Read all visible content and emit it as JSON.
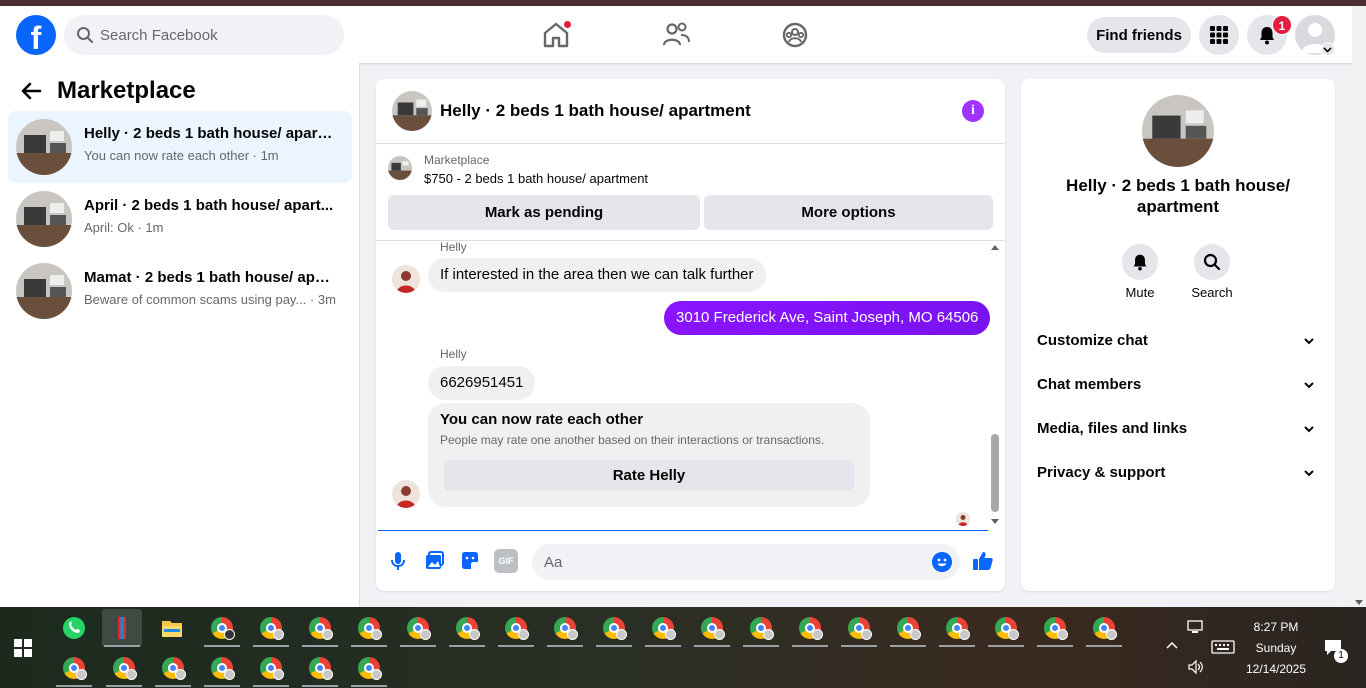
{
  "topnav": {
    "search_placeholder": "Search Facebook",
    "find_friends": "Find friends",
    "notification_count": "1",
    "logo": "f"
  },
  "sidebar": {
    "title": "Marketplace",
    "conversations": [
      {
        "title": "Helly · 2 beds 1 bath house/ apart...",
        "subtitle": "You can now rate each other · 1m",
        "active": true
      },
      {
        "title": "April · 2 beds 1 bath house/ apart...",
        "subtitle": "April: Ok · 1m",
        "active": false
      },
      {
        "title": "Mamat · 2 beds 1 bath house/ apa...",
        "subtitle": "Beware of common scams using pay... · 3m",
        "active": false
      }
    ]
  },
  "chat": {
    "header_title": "Helly · 2 beds 1 bath house/ apartment",
    "info_glyph": "i",
    "listing": {
      "source": "Marketplace",
      "title": "$750 - 2 beds 1 bath house/ apartment",
      "mark_pending": "Mark as pending",
      "more_options": "More options"
    },
    "messages": {
      "sender1": "Helly",
      "msg1": "If interested in the area then we can talk further",
      "msg_out": "3010 Frederick Ave, Saint Joseph, MO 64506",
      "sender2": "Helly",
      "msg2": "6626951451",
      "rate_title": "You can now rate each other",
      "rate_sub": "People may rate one another based on their interactions or transactions.",
      "rate_button": "Rate Helly"
    },
    "composer": {
      "placeholder": "Aa",
      "gif_label": "GIF"
    }
  },
  "rpanel": {
    "title": "Helly · 2 beds 1 bath house/ apartment",
    "mute": "Mute",
    "search": "Search",
    "sections": [
      "Customize chat",
      "Chat members",
      "Media, files and links",
      "Privacy & support"
    ]
  },
  "taskbar": {
    "time": "8:27 PM",
    "day": "Sunday",
    "date": "12/14/2025",
    "action_center_count": "1"
  },
  "colors": {
    "brand": "#0866ff",
    "accent_purple": "#7b12f5",
    "badge_red": "#e41e3f",
    "active_row": "#ebf5ff"
  },
  "icons": [
    "home-icon",
    "friends-icon",
    "groups-icon",
    "menu-grid-icon",
    "bell-icon",
    "search-icon",
    "mic-icon",
    "photo-icon",
    "sticker-icon",
    "gif-icon",
    "emoji-icon",
    "like-icon",
    "chevron-down-icon",
    "back-arrow-icon"
  ]
}
